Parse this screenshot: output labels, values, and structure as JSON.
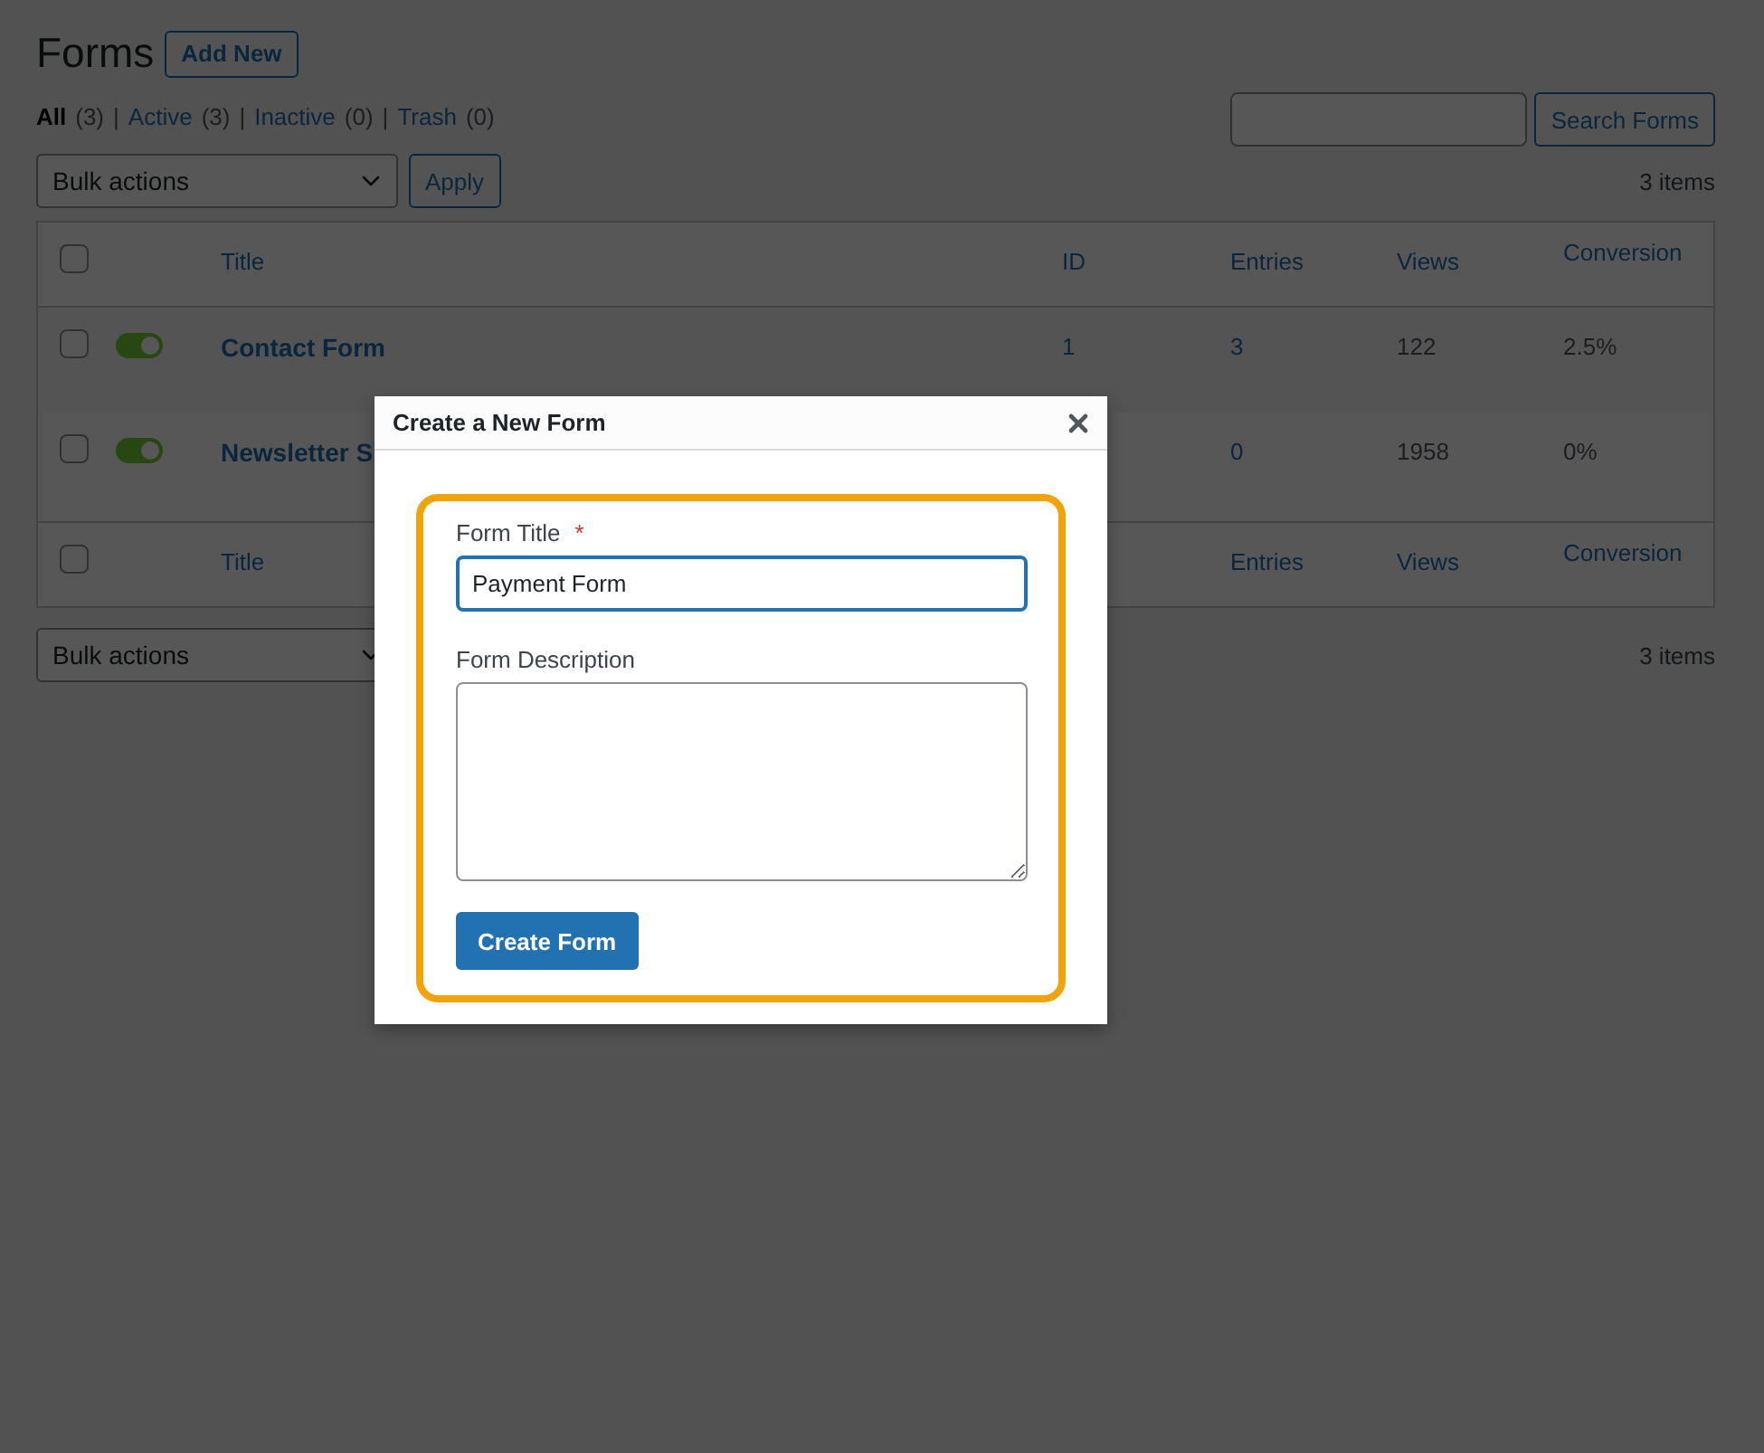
{
  "page": {
    "title": "Forms",
    "add_new": "Add New"
  },
  "filters": [
    {
      "label": "All",
      "count": "(3)",
      "selected": true
    },
    {
      "label": "Active",
      "count": "(3)",
      "selected": false
    },
    {
      "label": "Inactive",
      "count": "(0)",
      "selected": false
    },
    {
      "label": "Trash",
      "count": "(0)",
      "selected": false
    }
  ],
  "filter_separator": "|",
  "search": {
    "button": "Search Forms"
  },
  "top_actions": {
    "select": "Bulk actions",
    "apply": "Apply",
    "count": "3 items"
  },
  "table": {
    "header": {
      "checked": false,
      "title": "Title",
      "id": "ID",
      "entries": "Entries",
      "views": "Views",
      "conversion": "Conversion"
    },
    "rows": [
      {
        "checked": false,
        "on": true,
        "title": "Contact Form",
        "id": "1",
        "entries": "3",
        "views": "122",
        "conversion": "2.5%"
      },
      {
        "checked": false,
        "on": true,
        "title": "Newsletter S",
        "entries": "0",
        "views": "1958",
        "conversion": "0%"
      }
    ],
    "footer": {
      "checked": false,
      "title": "Title",
      "entries": "Entries",
      "views": "Views",
      "conversion": "Conversion"
    }
  },
  "bottom_actions": {
    "select": "Bulk actions",
    "count": "3 items"
  },
  "dialog": {
    "title": "Create a New Form",
    "fields": [
      {
        "kind": "text",
        "label": "Form Title",
        "required_mark": "*",
        "value": "Payment Form",
        "focused": true
      },
      {
        "kind": "textarea",
        "label": "Form Description",
        "focused": false
      }
    ],
    "submit": "Create Form"
  }
}
